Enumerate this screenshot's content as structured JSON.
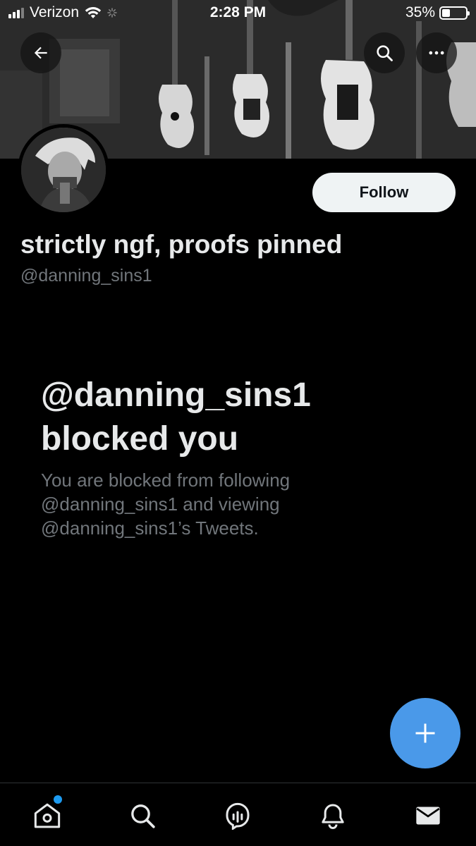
{
  "status_bar": {
    "carrier": "Verizon",
    "time": "2:28 PM",
    "battery_percent": "35%",
    "battery_level": 0.35
  },
  "header": {
    "back_icon": "arrow-left-icon",
    "search_icon": "search-icon",
    "more_icon": "more-horizontal-icon"
  },
  "profile": {
    "display_name": "strictly ngf, proofs pinned",
    "handle": "@danning_sins1",
    "follow_label": "Follow"
  },
  "blocked": {
    "title": "@danning_sins1 blocked you",
    "description": "You are blocked from following @danning_sins1 and viewing @danning_sins1’s Tweets."
  },
  "fab": {
    "icon": "plus-icon"
  },
  "tab_bar": {
    "items": [
      {
        "icon": "home-icon",
        "has_badge": true
      },
      {
        "icon": "search-icon"
      },
      {
        "icon": "spaces-icon"
      },
      {
        "icon": "bell-icon"
      },
      {
        "icon": "mail-icon"
      }
    ]
  },
  "colors": {
    "background": "#000000",
    "accent": "#1d9bf0",
    "fab": "#4a99e9",
    "secondary_text": "#71767b",
    "follow_button_bg": "#eff3f4"
  }
}
